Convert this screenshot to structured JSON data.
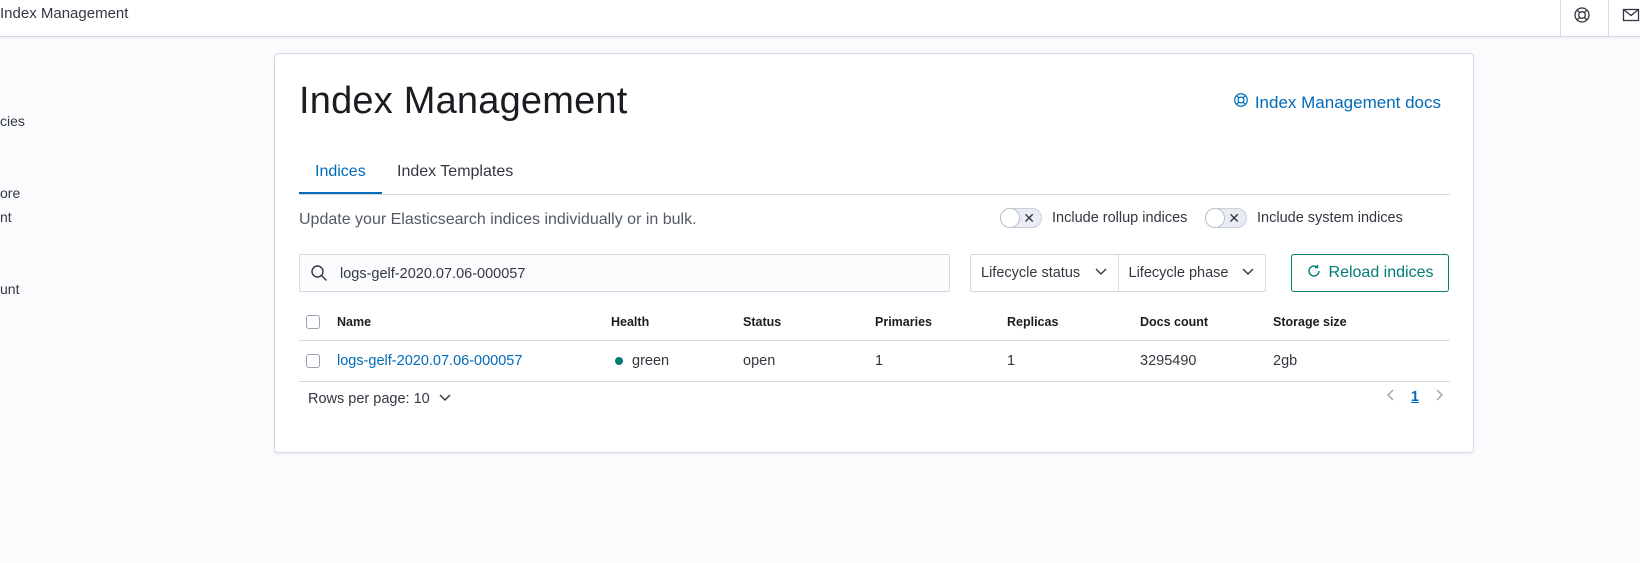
{
  "header": {
    "breadcrumb": "Index Management",
    "icons": [
      "help-icon",
      "mail-icon"
    ]
  },
  "sidenav": {
    "fragments": [
      "cies",
      "ore",
      "nt",
      "unt"
    ]
  },
  "page": {
    "title": "Index Management",
    "docs_link": "Index Management docs",
    "tabs": [
      {
        "label": "Indices",
        "active": true
      },
      {
        "label": "Index Templates",
        "active": false
      }
    ],
    "description": "Update your Elasticsearch indices individually or in bulk.",
    "toggles": {
      "rollup": "Include rollup indices",
      "system": "Include system indices"
    },
    "search": {
      "value": "logs-gelf-2020.07.06-000057"
    },
    "filters": {
      "lifecycle_status": "Lifecycle status",
      "lifecycle_phase": "Lifecycle phase"
    },
    "reload_label": "Reload indices"
  },
  "table": {
    "columns": [
      "Name",
      "Health",
      "Status",
      "Primaries",
      "Replicas",
      "Docs count",
      "Storage size"
    ],
    "rows": [
      {
        "name": "logs-gelf-2020.07.06-000057",
        "health": "green",
        "status": "open",
        "primaries": "1",
        "replicas": "1",
        "docs_count": "3295490",
        "storage_size": "2gb"
      }
    ]
  },
  "pagination": {
    "rows_per_page": "Rows per page: 10",
    "current_page": "1"
  },
  "colors": {
    "accent_link": "#006bb8",
    "primary_button": "#017d73",
    "health_green": "#017d73"
  }
}
